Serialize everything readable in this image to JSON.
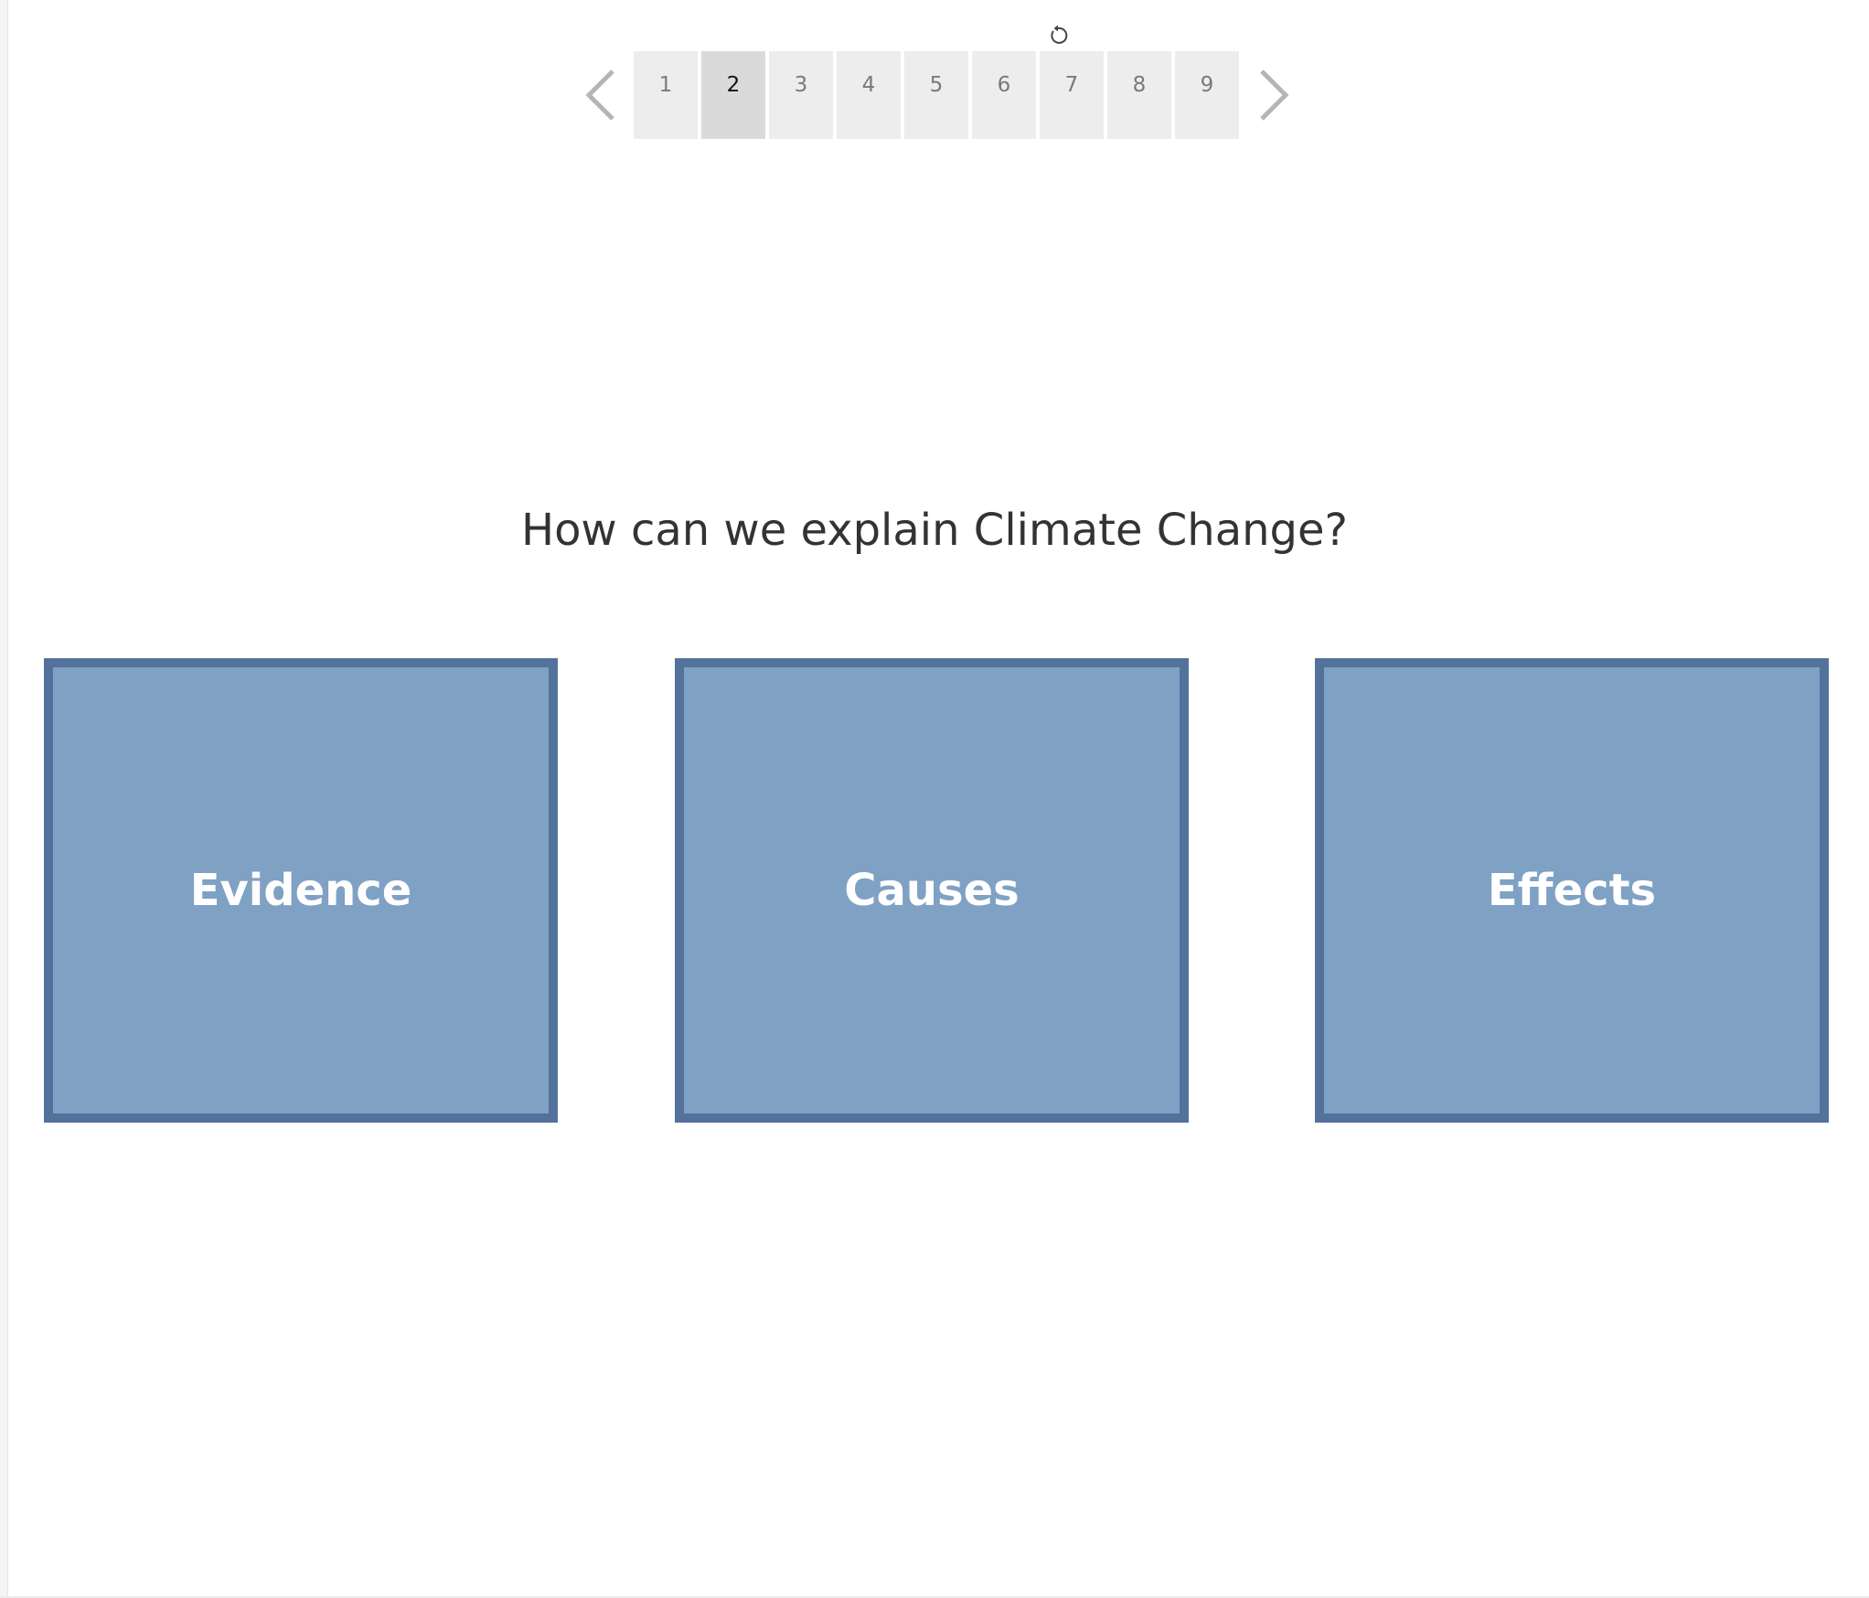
{
  "navigator": {
    "pages": [
      "1",
      "2",
      "3",
      "4",
      "5",
      "6",
      "7",
      "8",
      "9"
    ],
    "active_page": "2",
    "icons": {
      "previous": "chevron-left-icon",
      "next": "chevron-right-icon",
      "revert": "revert-icon"
    }
  },
  "main": {
    "question": "How can we explain Climate Change?",
    "cards": [
      {
        "label": "Evidence"
      },
      {
        "label": "Causes"
      },
      {
        "label": "Effects"
      }
    ]
  },
  "colors": {
    "card_fill": "#7fa1c4",
    "card_border": "#53729b",
    "tab_bg": "#ededed",
    "tab_active_bg": "#dadada",
    "heading_text": "#333333"
  }
}
